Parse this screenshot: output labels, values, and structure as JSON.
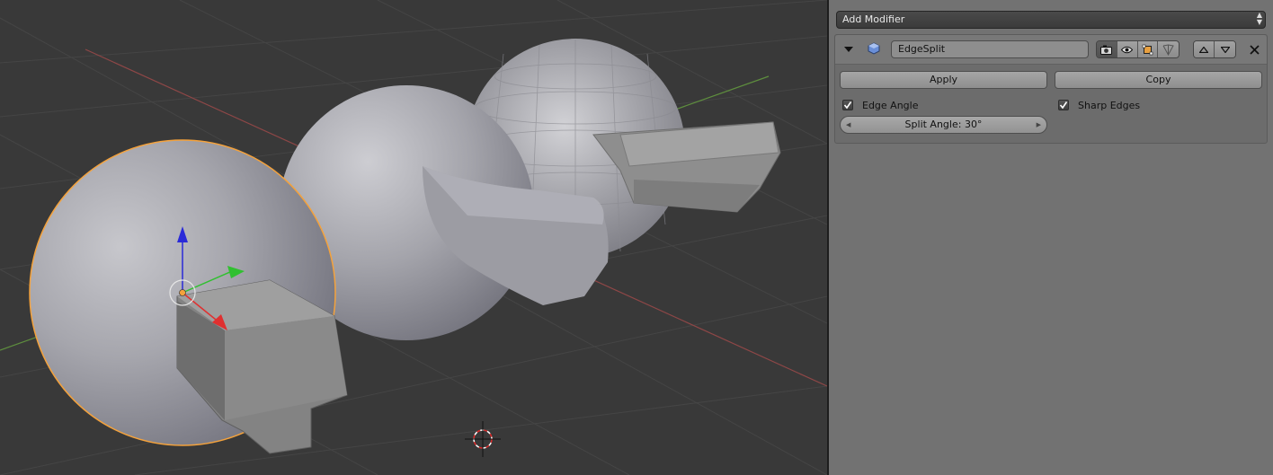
{
  "viewport": {
    "colors": {
      "background": "#393939",
      "grid": "#454545",
      "x_axis": "#8e4747",
      "y_axis": "#5e8e3e",
      "selection_outline": "#f4a23c"
    }
  },
  "properties": {
    "add_modifier_label": "Add Modifier",
    "modifier": {
      "name": "EdgeSplit",
      "icons": [
        "camera-icon",
        "eye-icon",
        "edit-mode-icon",
        "cage-icon",
        "move-up-icon",
        "move-down-icon",
        "close-icon"
      ],
      "apply_label": "Apply",
      "copy_label": "Copy",
      "edge_angle": {
        "label": "Edge Angle",
        "checked": true
      },
      "sharp_edges": {
        "label": "Sharp Edges",
        "checked": true
      },
      "split_angle": "Split Angle: 30°"
    }
  }
}
